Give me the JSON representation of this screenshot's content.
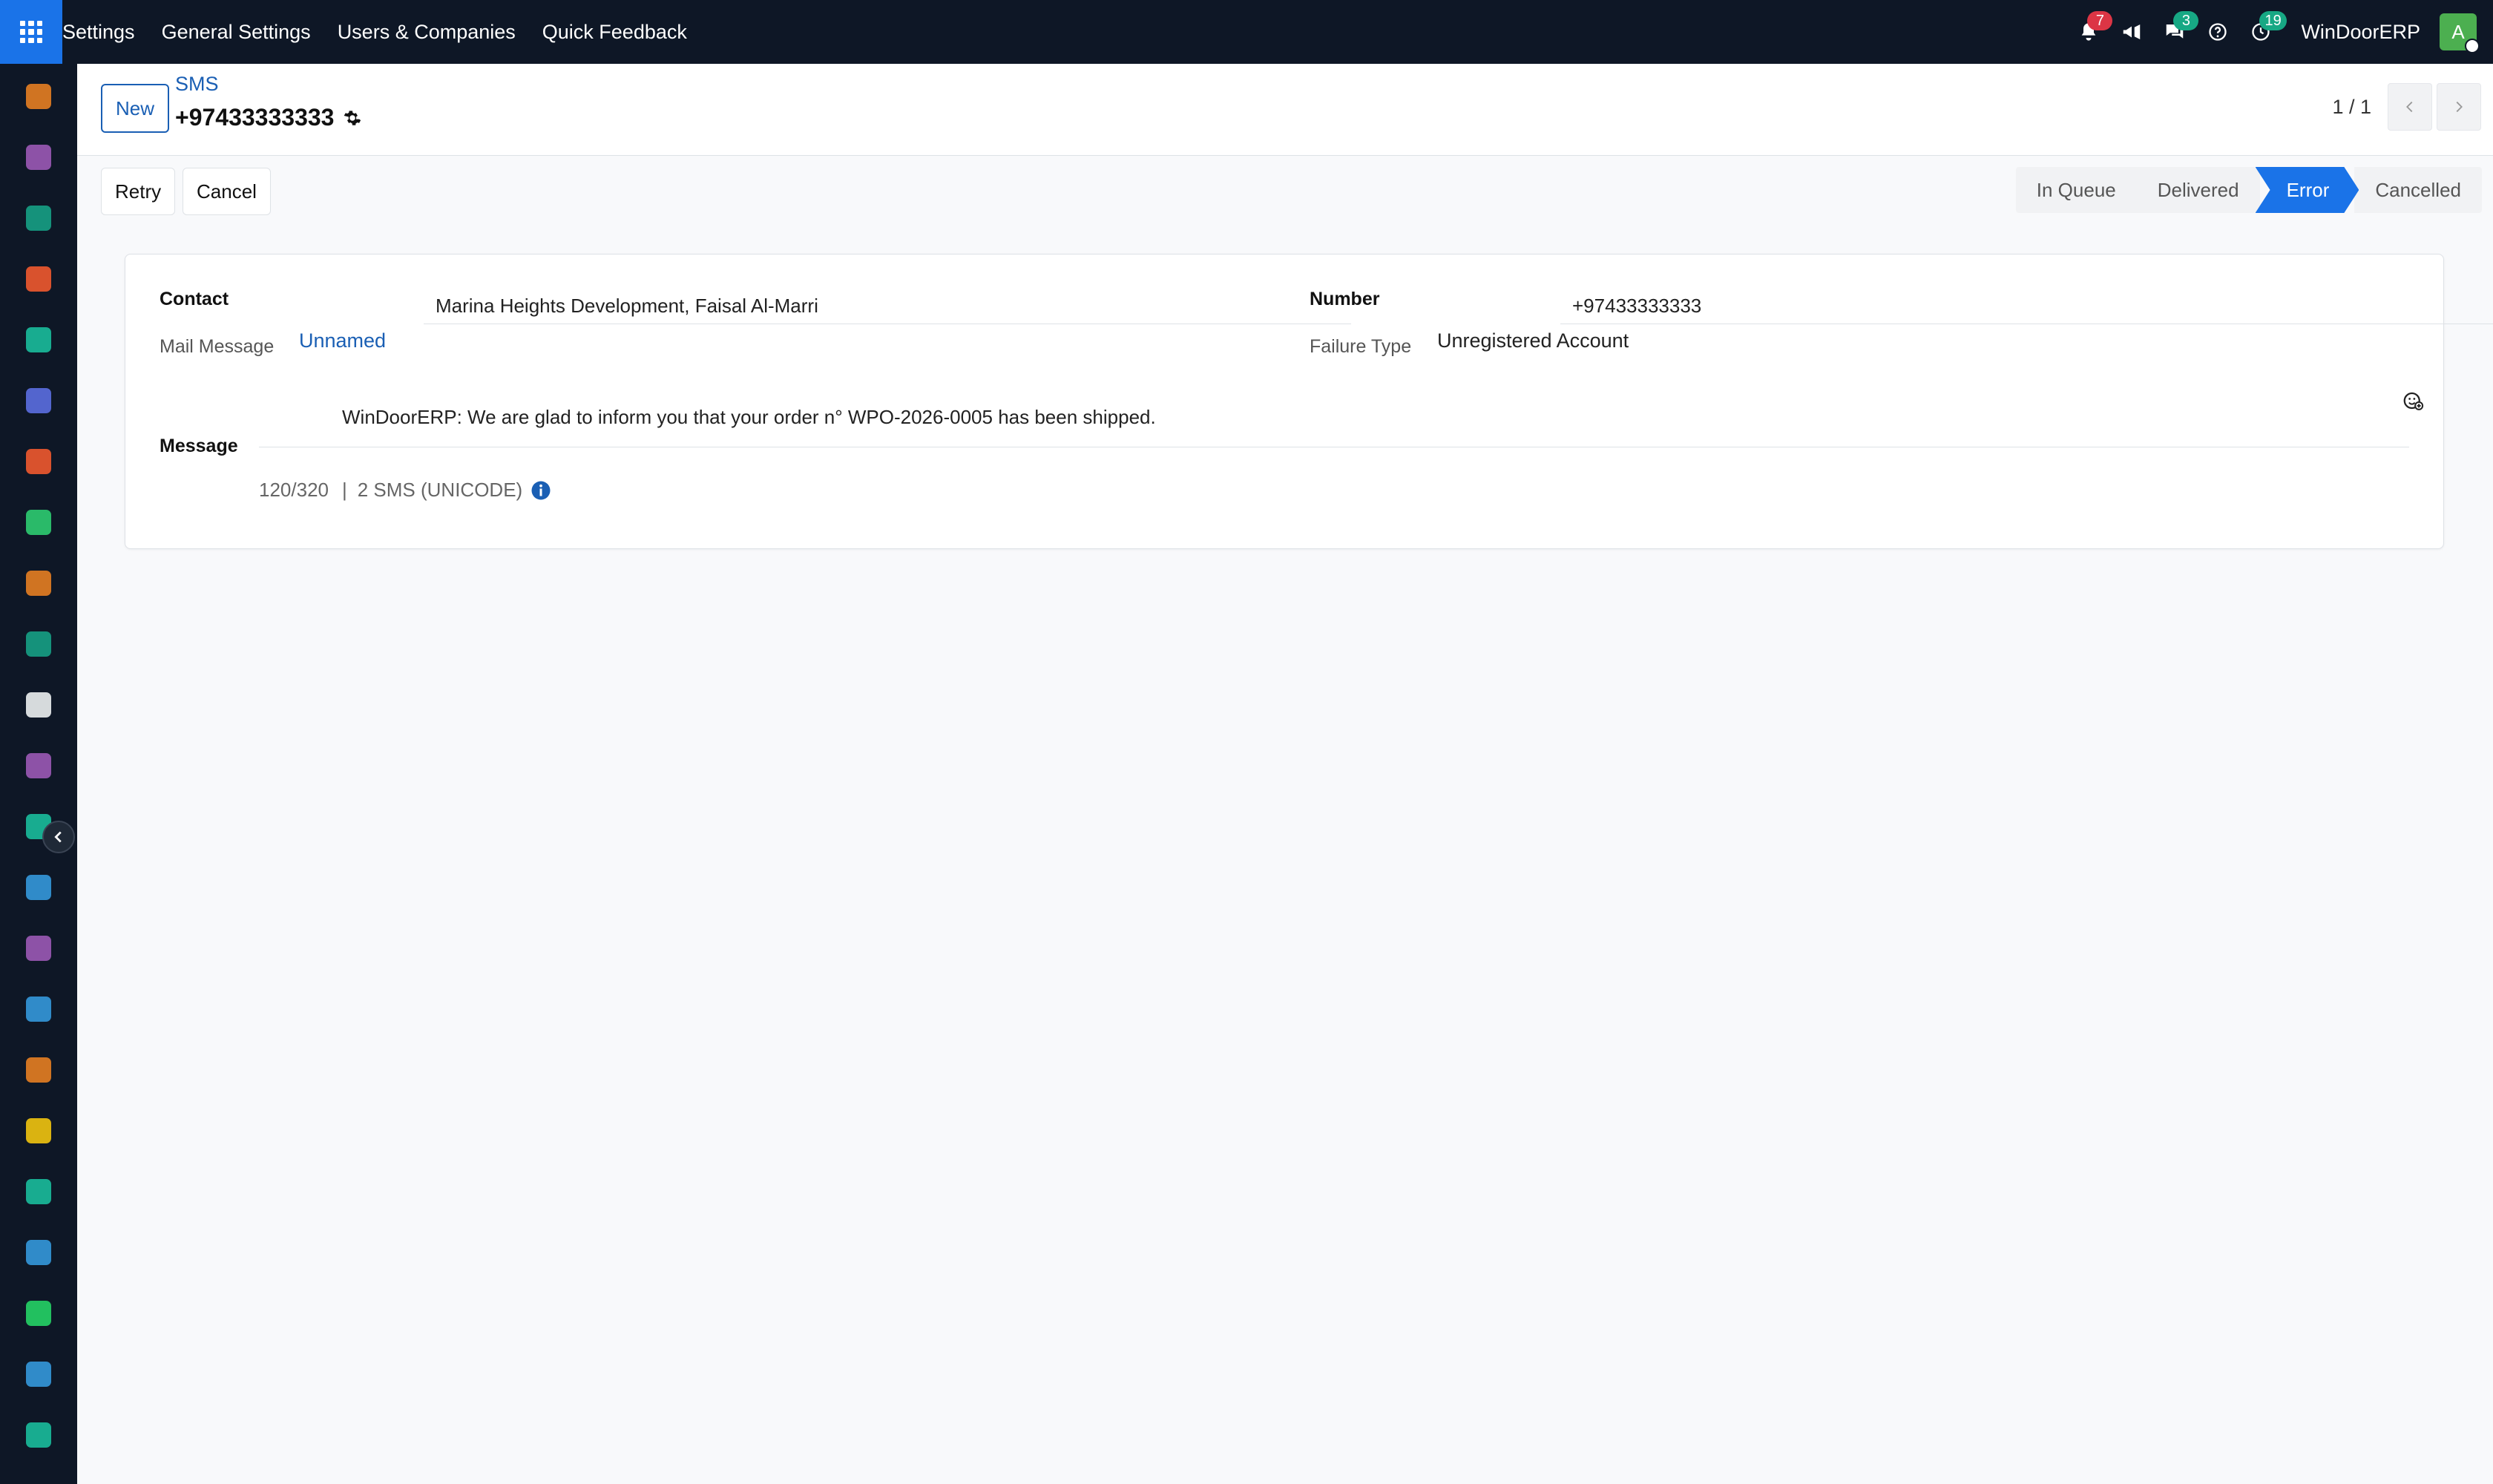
{
  "topbar": {
    "menu": [
      "Settings",
      "General Settings",
      "Users & Companies",
      "Quick Feedback"
    ],
    "notifications_count": "7",
    "messages_count": "3",
    "activities_count": "19",
    "company": "WinDoorERP",
    "avatar_initial": "A"
  },
  "sidebar": {
    "apps": [
      {
        "icon": "dashboard-icon",
        "color": "#e67e22"
      },
      {
        "icon": "knowledge-icon",
        "color": "#9b59b6"
      },
      {
        "icon": "contacts-icon",
        "color": "#16a085"
      },
      {
        "icon": "discuss-icon",
        "color": "#f0592f"
      },
      {
        "icon": "live-icon",
        "color": "#1abc9c"
      },
      {
        "icon": "email-marketing-icon",
        "color": "#5b6ee1"
      },
      {
        "icon": "livechat-icon",
        "color": "#f0592f"
      },
      {
        "icon": "invoicing-icon",
        "color": "#2ecc71"
      },
      {
        "icon": "reporting-icon",
        "color": "#e67e22"
      },
      {
        "icon": "employees-icon",
        "color": "#16a085"
      },
      {
        "icon": "inventory-icon",
        "color": "#ecf0f1"
      },
      {
        "icon": "notes-icon",
        "color": "#9b59b6"
      },
      {
        "icon": "tasks-icon",
        "color": "#1abc9c"
      },
      {
        "icon": "elearning-icon",
        "color": "#3498db"
      },
      {
        "icon": "products-icon",
        "color": "#9b59b6"
      },
      {
        "icon": "sales-icon",
        "color": "#3498db"
      },
      {
        "icon": "team-icon",
        "color": "#e67e22"
      },
      {
        "icon": "calendar-icon",
        "color": "#f1c40f"
      },
      {
        "icon": "sign-icon",
        "color": "#1abc9c"
      },
      {
        "icon": "apps-icon",
        "color": "#3498db"
      },
      {
        "icon": "whatsapp-icon",
        "color": "#25d366"
      },
      {
        "icon": "timer-icon",
        "color": "#3498db"
      },
      {
        "icon": "website-icon",
        "color": "#1abc9c"
      }
    ]
  },
  "control_panel": {
    "new_label": "New",
    "breadcrumb": "SMS",
    "record_title": "+97433333333",
    "pager": "1 / 1"
  },
  "actions": {
    "retry_label": "Retry",
    "cancel_label": "Cancel"
  },
  "statusbar": {
    "stages": [
      "In Queue",
      "Delivered",
      "Error",
      "Cancelled"
    ],
    "active": "Error",
    "active_color": "#1a73e8"
  },
  "form": {
    "contact_label": "Contact",
    "contact_value": "Marina Heights Development, Faisal Al-Marri",
    "mail_message_label": "Mail Message",
    "mail_message_value": "Unnamed",
    "number_label": "Number",
    "number_value": "+97433333333",
    "failure_type_label": "Failure Type",
    "failure_type_value": "Unregistered Account",
    "message_label": "Message",
    "message_value": "WinDoorERP: We are glad to inform you that your order n° WPO-2026-0005 has been shipped.",
    "char_count": "120/320",
    "sms_count": "2 SMS (UNICODE)"
  }
}
